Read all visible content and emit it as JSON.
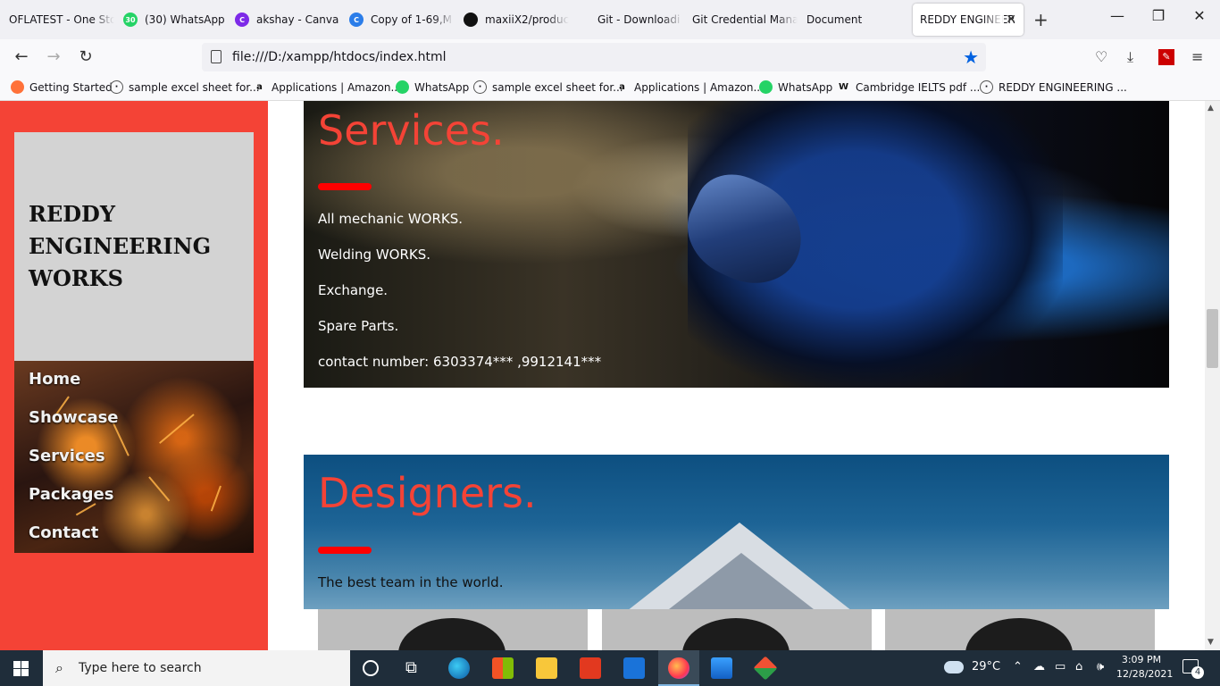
{
  "browser": {
    "tabs": [
      {
        "title": "OFLATEST - One Sto",
        "color": "#ff6600",
        "icon": ""
      },
      {
        "title": "(30) WhatsApp",
        "color": "#25d366",
        "icon": "30"
      },
      {
        "title": "akshay - Canva",
        "color": "#7d2ae8",
        "icon": "C"
      },
      {
        "title": "Copy of 1-69,M",
        "color": "#2b7de9",
        "icon": "C"
      },
      {
        "title": "maxiiX2/produc",
        "color": "#111111",
        "icon": ""
      },
      {
        "title": "Git - Downloadi",
        "color": "#f05133",
        "icon": ""
      },
      {
        "title": "Git Credential Mana",
        "color": "#888888",
        "icon": ""
      },
      {
        "title": "Document",
        "color": "#cccccc",
        "icon": ""
      },
      {
        "title": "REDDY ENGINEER",
        "color": "#cccccc",
        "icon": ""
      }
    ],
    "url": "file:///D:/xampp/htdocs/index.html",
    "bookmarks": [
      {
        "label": "Getting Started",
        "icon": "firefox-icon",
        "color": "#ff7139"
      },
      {
        "label": "sample excel sheet for...",
        "icon": "globe-icon",
        "color": "#555555"
      },
      {
        "label": "Applications | Amazon...",
        "icon": "amazon-icon",
        "color": "#111111"
      },
      {
        "label": "WhatsApp",
        "icon": "whatsapp-icon",
        "color": "#25d366"
      },
      {
        "label": "sample excel sheet for...",
        "icon": "globe-icon",
        "color": "#555555"
      },
      {
        "label": "Applications | Amazon...",
        "icon": "amazon-icon",
        "color": "#111111"
      },
      {
        "label": "WhatsApp",
        "icon": "whatsapp-icon",
        "color": "#25d366"
      },
      {
        "label": "Cambridge IELTS pdf ...",
        "icon": "w-icon",
        "color": "#111111"
      },
      {
        "label": "REDDY ENGINEERING ...",
        "icon": "globe-icon",
        "color": "#555555"
      }
    ]
  },
  "page": {
    "brand": {
      "line1": "REDDY",
      "line2": "ENGINEERING",
      "line3": "WORKS"
    },
    "menu": [
      "Home",
      "Showcase",
      "Services",
      "Packages",
      "Contact"
    ],
    "services": {
      "title": "Services.",
      "items": [
        "All mechanic WORKS.",
        "Welding WORKS.",
        "Exchange.",
        "Spare Parts.",
        "contact number: 6303374*** ,9912141***"
      ]
    },
    "designers": {
      "title": "Designers.",
      "subtitle": "The best team in the world."
    },
    "colors": {
      "sidebar": "#f44336",
      "accent_bar": "#ff0000",
      "brand_box": "#d3d3d3"
    }
  },
  "taskbar": {
    "search_placeholder": "Type here to search",
    "weather": "29°C",
    "time": "3:09 PM",
    "date": "12/28/2021",
    "notifications": "4"
  }
}
